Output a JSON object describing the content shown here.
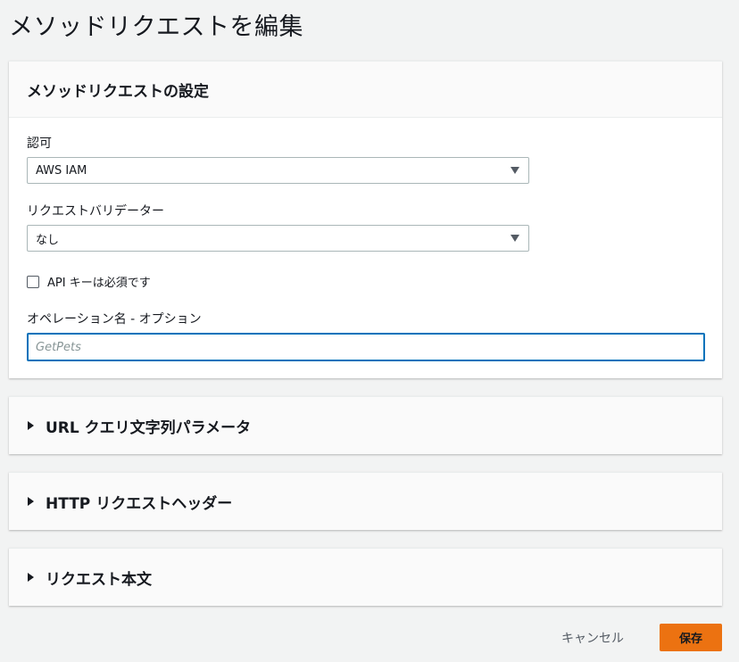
{
  "page": {
    "title": "メソッドリクエストを編集"
  },
  "settings": {
    "header": "メソッドリクエストの設定",
    "authorization": {
      "label": "認可",
      "value": "AWS IAM"
    },
    "validator": {
      "label": "リクエストバリデーター",
      "value": "なし"
    },
    "api_key": {
      "label": "API キーは必須です",
      "checked": false
    },
    "operation_name": {
      "label": "オペレーション名 - オプション",
      "placeholder": "GetPets",
      "value": ""
    }
  },
  "sections": [
    {
      "label": "URL クエリ文字列パラメータ"
    },
    {
      "label": "HTTP リクエストヘッダー"
    },
    {
      "label": "リクエスト本文"
    }
  ],
  "footer": {
    "cancel_label": "キャンセル",
    "save_label": "保存"
  },
  "colors": {
    "primary": "#ec7211",
    "focus": "#0073bb",
    "background": "#f2f3f3"
  }
}
